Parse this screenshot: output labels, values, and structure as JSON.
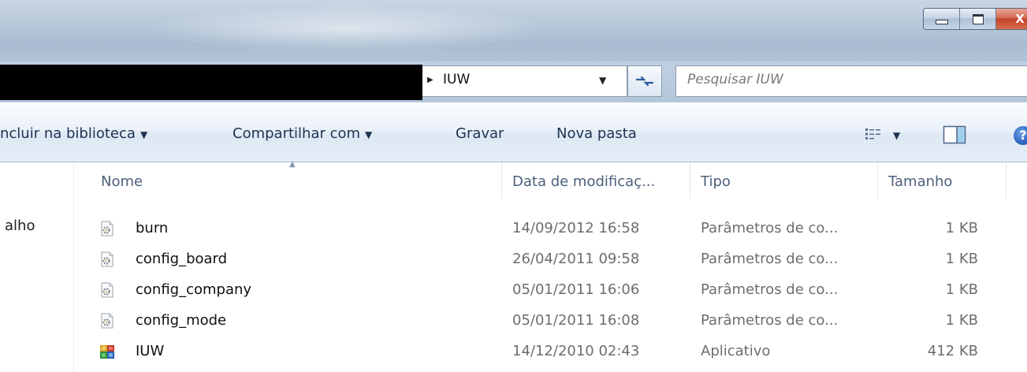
{
  "window": {
    "close_label": "X"
  },
  "address": {
    "crumb": "IUW",
    "search_placeholder": "Pesquisar IUW"
  },
  "toolbar": {
    "include_library": "ncluir na biblioteca",
    "share_with": "Compartilhar com",
    "burn": "Gravar",
    "new_folder": "Nova pasta",
    "help": "?"
  },
  "nav": {
    "fragment": "alho"
  },
  "columns": {
    "name": "Nome",
    "date": "Data de modificaç...",
    "type": "Tipo",
    "size": "Tamanho"
  },
  "files": [
    {
      "name": "burn",
      "date": "14/09/2012 16:58",
      "type": "Parâmetros de co...",
      "size": "1 KB",
      "icon": "config-file-icon"
    },
    {
      "name": "config_board",
      "date": "26/04/2011 09:58",
      "type": "Parâmetros de co...",
      "size": "1 KB",
      "icon": "config-file-icon"
    },
    {
      "name": "config_company",
      "date": "05/01/2011 16:06",
      "type": "Parâmetros de co...",
      "size": "1 KB",
      "icon": "config-file-icon"
    },
    {
      "name": "config_mode",
      "date": "05/01/2011 16:08",
      "type": "Parâmetros de co...",
      "size": "1 KB",
      "icon": "config-file-icon"
    },
    {
      "name": "IUW",
      "date": "14/12/2010 02:43",
      "type": "Aplicativo",
      "size": "412 KB",
      "icon": "application-icon"
    }
  ],
  "colors": {
    "title_bar": "#b9c9da",
    "command_text": "#1e3250",
    "header_text": "#4c607a",
    "detail_text": "#6d6d6d",
    "close_button": "#c34024"
  }
}
